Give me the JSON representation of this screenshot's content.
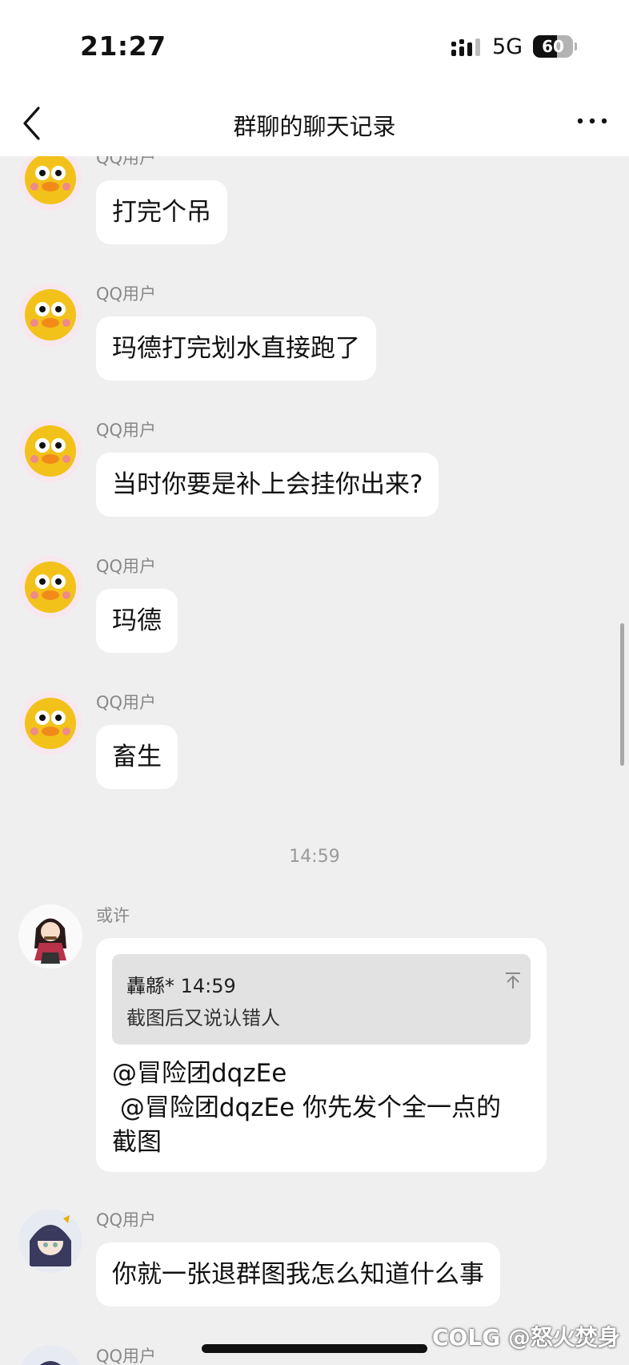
{
  "status_bar": {
    "time": "21:27",
    "network": "5G",
    "battery": "60",
    "battery_level": 0.6
  },
  "nav": {
    "title": "群聊的聊天记录"
  },
  "messages": [
    {
      "sender": "QQ用户",
      "text": "打完个吊",
      "avatar": "duck-avatar"
    },
    {
      "sender": "QQ用户",
      "text": "玛德打完划水直接跑了",
      "avatar": "duck-avatar"
    },
    {
      "sender": "QQ用户",
      "text": "当时你要是补上会挂你出来?",
      "avatar": "duck-avatar"
    },
    {
      "sender": "QQ用户",
      "text": "玛德",
      "avatar": "duck-avatar"
    },
    {
      "sender": "QQ用户",
      "text": "畜生",
      "avatar": "duck-avatar"
    }
  ],
  "timestamp": "14:59",
  "reply_message": {
    "sender": "或许",
    "avatar": "anime-girl-avatar",
    "quote_author": "轟緜*",
    "quote_time": "14:59",
    "quote_text": "截图后又说认错人",
    "lines": [
      "@冒险团dqzEe",
      " @冒险团dqzEe 你先发个全一点的",
      "截图"
    ]
  },
  "after_messages": [
    {
      "sender": "QQ用户",
      "text": "你就一张退群图我怎么知道什么事",
      "avatar": "anime-avatar"
    },
    {
      "sender": "QQ用户",
      "avatar": "anime-avatar"
    }
  ],
  "watermark": "COLG @怒火焚身"
}
